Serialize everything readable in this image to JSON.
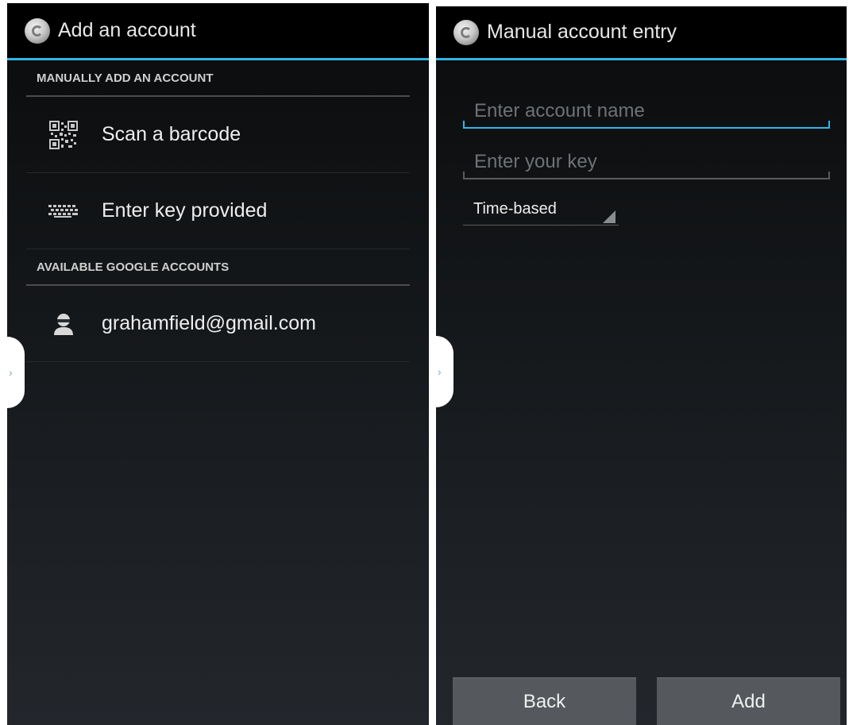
{
  "left_screen": {
    "title": "Add an account",
    "section_manual": "MANUALLY ADD AN ACCOUNT",
    "items_manual": [
      {
        "label": "Scan a barcode",
        "icon": "qr-code-icon"
      },
      {
        "label": "Enter key provided",
        "icon": "keyboard-icon"
      }
    ],
    "section_google": "AVAILABLE GOOGLE ACCOUNTS",
    "items_google": [
      {
        "label": "grahamfield@gmail.com",
        "icon": "person-icon"
      }
    ]
  },
  "right_screen": {
    "title": "Manual account entry",
    "account_name_placeholder": "Enter account name",
    "key_placeholder": "Enter your key",
    "type_selected": "Time-based",
    "back_label": "Back",
    "add_label": "Add"
  },
  "colors": {
    "accent": "#33b5e5",
    "background": "#111315",
    "button": "#55595d"
  }
}
